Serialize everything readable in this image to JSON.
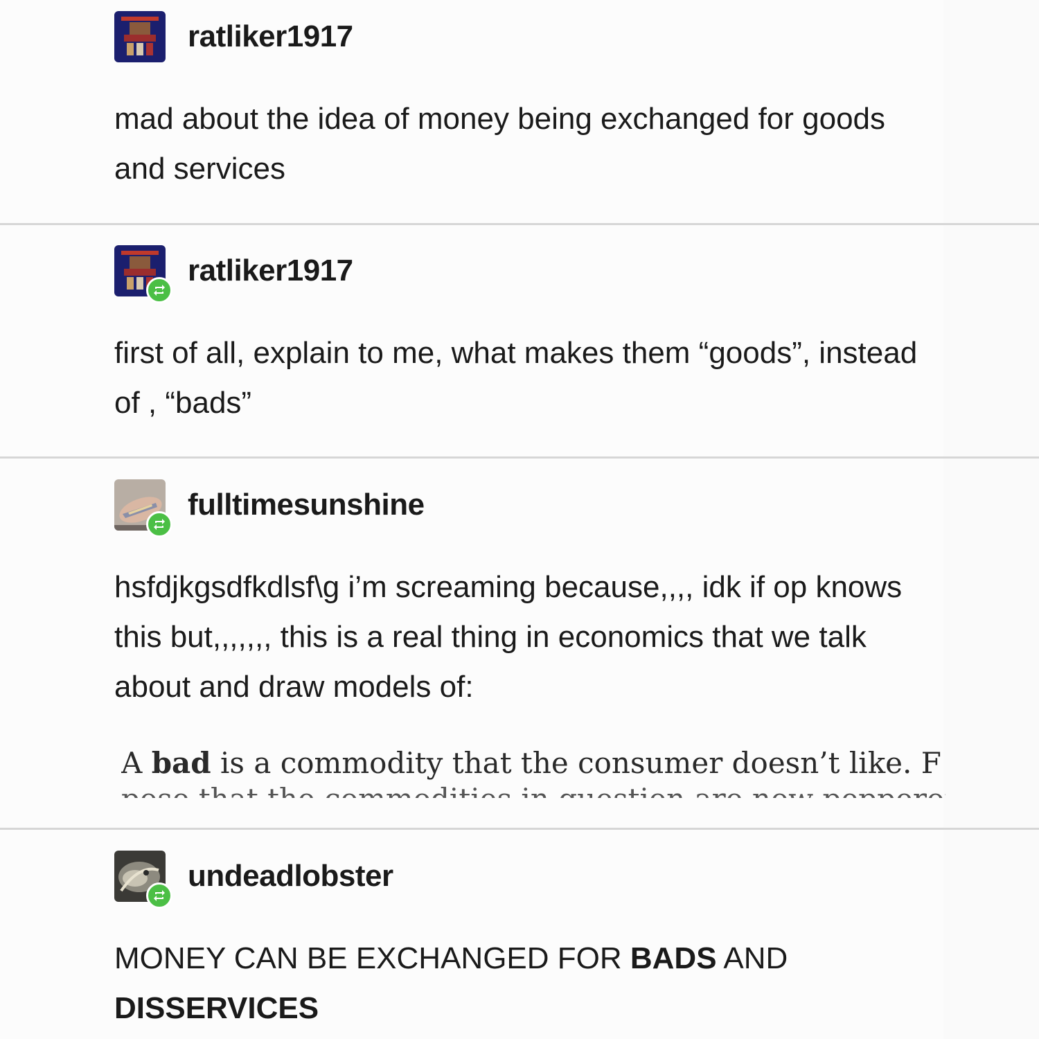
{
  "posts": [
    {
      "username": "ratliker1917",
      "reblog": false,
      "text": "mad about the idea of money being exchanged for goods and services"
    },
    {
      "username": "ratliker1917",
      "reblog": true,
      "text": "first of all, explain to me, what makes them “goods”, instead of , “bads”"
    },
    {
      "username": "fulltimesunshine",
      "reblog": true,
      "text": "hsfdjkgsdfkdlsf\\g i’m screaming because,,,, idk if op knows this but,,,,,,, this is a real thing in economics that we talk about and draw models of:",
      "excerpt": {
        "lead": "A ",
        "bold": "bad",
        "rest": " is a commodity that the consumer doesn’t like.  F",
        "cut": "pose that the commodities in question are now pepperoni"
      }
    },
    {
      "username": "undeadlobster",
      "reblog": true,
      "text_plain_1": "MONEY CAN BE EXCHANGED FOR ",
      "text_bold_1": "BADS",
      "text_plain_2": " AND ",
      "text_bold_2": "DISSERVICES"
    }
  ],
  "colors": {
    "reblog_badge": "#4bbf45",
    "divider": "#d6d6d6",
    "text": "#1a1a1a"
  },
  "icons": {
    "reblog": "reblog-arrows-icon"
  }
}
